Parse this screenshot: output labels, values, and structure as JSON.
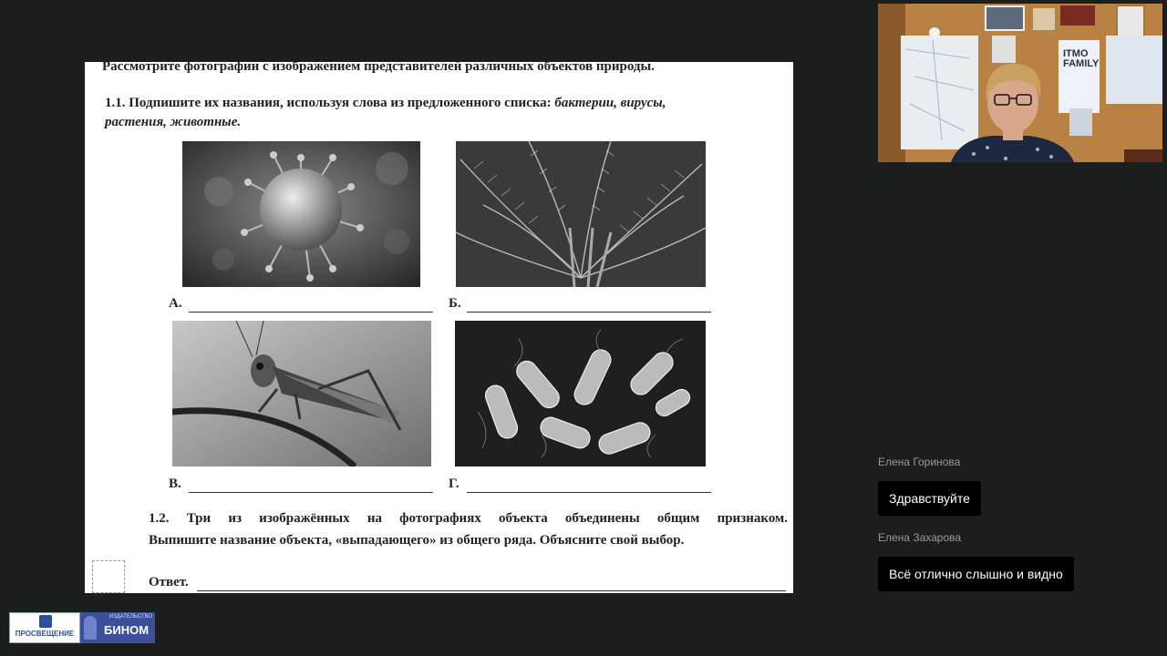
{
  "slide": {
    "intro": "Рассмотрите фотографии с изображением представителей различных объектов природы.",
    "q11_line1": "1.1. Подпишите их названия, используя слова из предложенного списка:",
    "q11_options_line1": "бактерии, вирусы,",
    "q11_options_line2": "растения, животные.",
    "photos": [
      {
        "label": "А.",
        "icon": "virus-photo"
      },
      {
        "label": "Б.",
        "icon": "fern-photo"
      },
      {
        "label": "В.",
        "icon": "grasshopper-photo"
      },
      {
        "label": "Г.",
        "icon": "bacteria-photo"
      }
    ],
    "q12_line1": "1.2. Три из изображённых на фотографиях объекта объединены общим признаком.",
    "q12_line2": "Выпишите название объекта, «выпадающего» из общего ряда. Объясните свой выбор.",
    "answer_label": "Ответ."
  },
  "video": {
    "poster_text_1": "ITMO",
    "poster_text_2": "FAMILY"
  },
  "chat": [
    {
      "author": "Елена Горинова",
      "message": "Здравствуйте"
    },
    {
      "author": "Елена Захарова",
      "message": "Всё отлично слышно и видно"
    }
  ],
  "logos": {
    "prosveshchenie": "ПРОСВЕЩЕНИЕ",
    "binom_sub": "ИЗДАТЕЛЬСТВО",
    "binom": "БИНОМ"
  },
  "colors": {
    "background": "#1c1d1d",
    "bubble": "#000000",
    "author": "#9a9a9a",
    "logo_blue": "#3b4f9a"
  }
}
